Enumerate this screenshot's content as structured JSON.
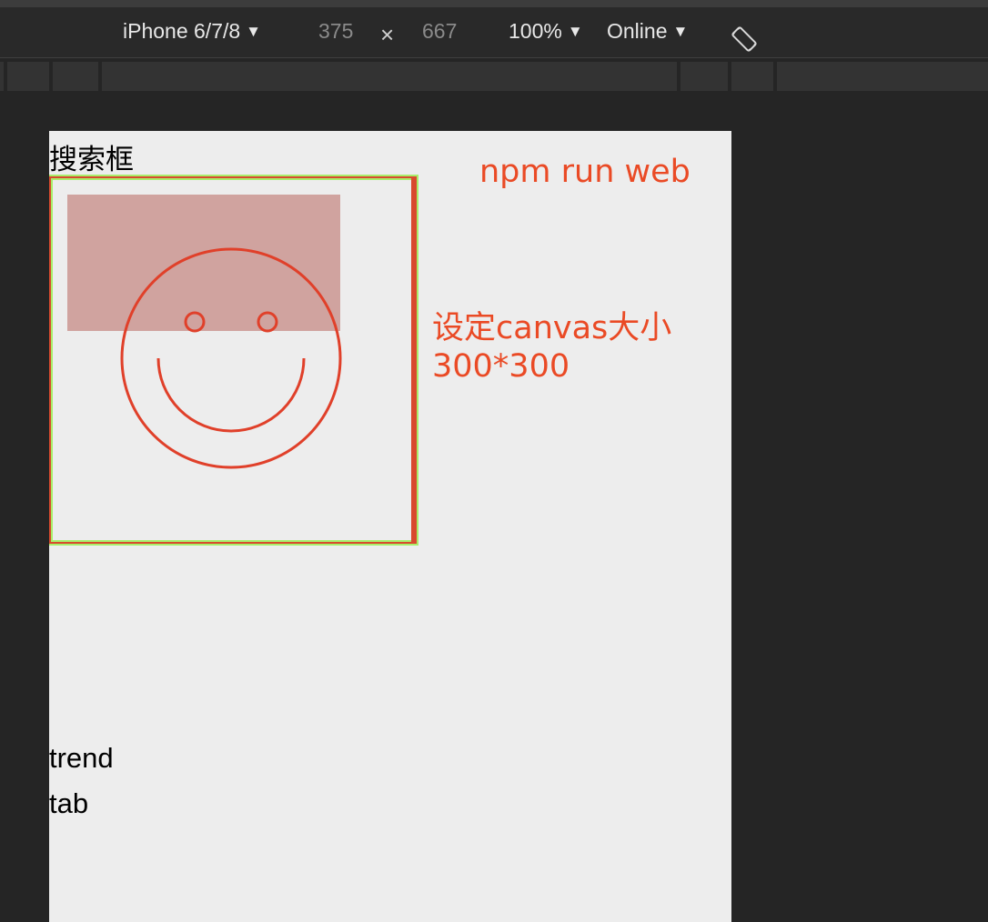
{
  "toolbar": {
    "device": "iPhone 6/7/8",
    "width": "375",
    "times": "×",
    "height": "667",
    "zoom": "100%",
    "network": "Online",
    "dropdown_glyph": "▼",
    "rotate_icon": "rotate-icon"
  },
  "page": {
    "search_label": "搜索框",
    "annotation_cmd": "npm run web",
    "annotation_size_line1": "设定canvas大小",
    "annotation_size_line2": "300*300",
    "trend_label": "trend",
    "tab_label": "tab"
  },
  "colors": {
    "annotation": "#ea4a25",
    "canvas_border": "#d84a2e",
    "highlight": "#a8ee6a",
    "rect_fill": "#d0a39f",
    "smiley_stroke": "#e0402a"
  }
}
